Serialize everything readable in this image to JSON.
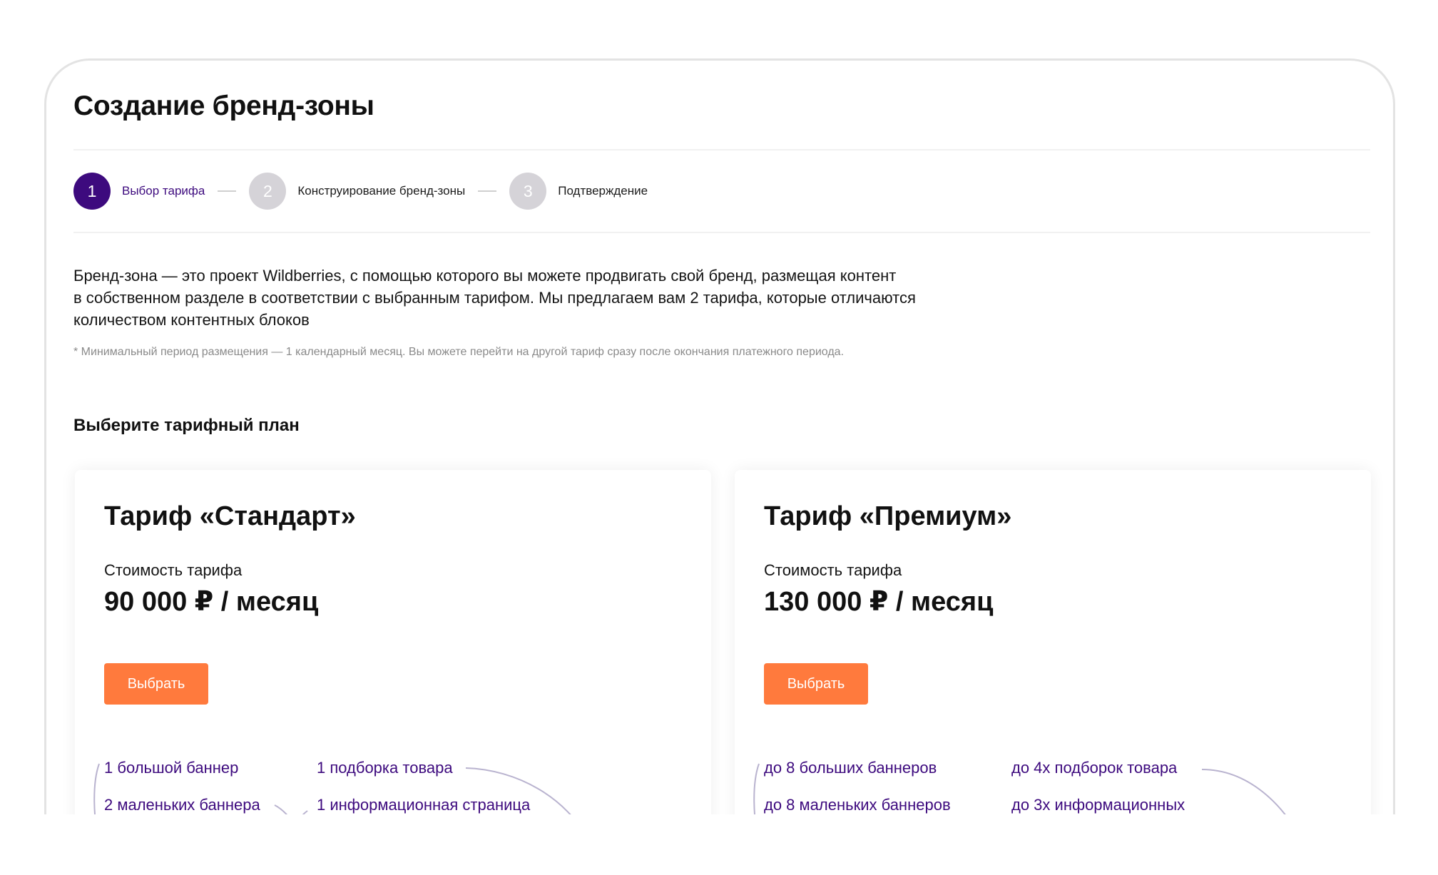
{
  "page": {
    "title": "Создание бренд-зоны"
  },
  "stepper": {
    "steps": [
      {
        "number": "1",
        "label": "Выбор тарифа",
        "active": true
      },
      {
        "number": "2",
        "label": "Конструирование бренд-зоны",
        "active": false
      },
      {
        "number": "3",
        "label": "Подтверждение",
        "active": false
      }
    ]
  },
  "intro": {
    "lines": [
      "Бренд-зона — это проект Wildberries, с помощью которого вы можете продвигать свой бренд, размещая контент",
      "в собственном разделе в соответствии с  выбранным тарифом. Мы предлагаем вам 2 тарифа, которые отличаются",
      "количеством контентных блоков"
    ],
    "note": "* Минимальный период размещения — 1 календарный месяц. Вы можете перейти на другой тариф сразу после окончания платежного периода."
  },
  "plans_section": {
    "title": "Выберите тарифный план"
  },
  "plans": [
    {
      "title": "Тариф «Стандарт»",
      "price_label": "Стоимость тарифа",
      "price": "90 000 ₽ / месяц",
      "button_label": "Выбрать",
      "features": [
        "1 большой баннер",
        "1 подборка товара",
        "2 маленьких баннера",
        "1 информационная страница"
      ]
    },
    {
      "title": "Тариф «Премиум»",
      "price_label": "Стоимость тарифа",
      "price": "130 000 ₽ / месяц",
      "button_label": "Выбрать",
      "features": [
        "до 8 больших баннеров",
        "до 4х подборок товара",
        "до 8 маленьких баннеров",
        "до 3х информационных"
      ]
    }
  ],
  "colors": {
    "accent": "#3d0a7e",
    "button": "#ff7a3d",
    "step_inactive": "#d5d3d8",
    "muted_text": "#8a8a8a",
    "decor_line": "#b9b3cf"
  }
}
